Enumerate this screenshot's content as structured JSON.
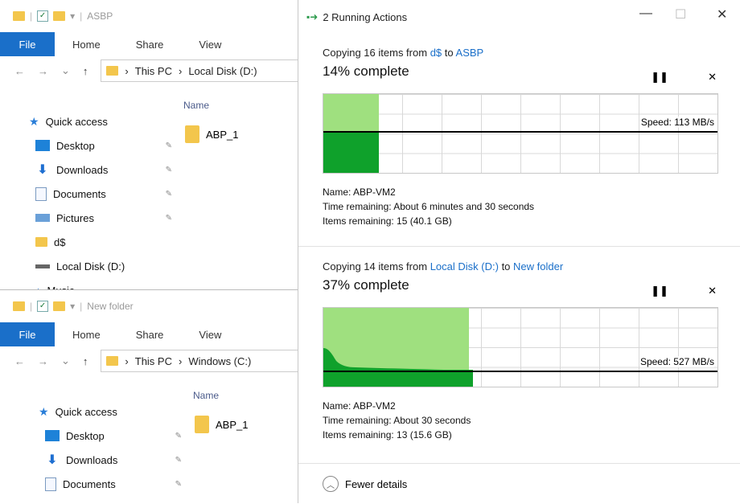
{
  "explorer_top": {
    "title": "ASBP",
    "ribbon": {
      "file": "File",
      "home": "Home",
      "share": "Share",
      "view": "View"
    },
    "address": {
      "this_pc": "This PC",
      "location": "Local Disk (D:)"
    },
    "column_header": "Name",
    "files": [
      "ABP_1"
    ],
    "nav": {
      "quick_access": "Quick access",
      "items": [
        "Desktop",
        "Downloads",
        "Documents",
        "Pictures",
        "d$",
        "Local Disk (D:)",
        "Music"
      ]
    }
  },
  "explorer_bottom": {
    "title": "New folder",
    "ribbon": {
      "file": "File",
      "home": "Home",
      "share": "Share",
      "view": "View"
    },
    "address": {
      "this_pc": "This PC",
      "location": "Windows (C:)"
    },
    "column_header": "Name",
    "files": [
      "ABP_1"
    ],
    "nav": {
      "quick_access": "Quick access",
      "items": [
        "Desktop",
        "Downloads",
        "Documents"
      ]
    }
  },
  "operations": {
    "title": "2 Running Actions",
    "copies": [
      {
        "prefix": "Copying 16 items from",
        "from": "d$",
        "to_word": "to",
        "to": "ASBP",
        "percent_text": "14% complete",
        "percent": 14,
        "speed": "Speed: 113 MB/s",
        "name": "Name:  ABP-VM2",
        "time_remaining": "Time remaining:  About 6 minutes and 30 seconds",
        "items_remaining": "Items remaining:  15 (40.1 GB)"
      },
      {
        "prefix": "Copying 14 items from",
        "from": "Local Disk (D:)",
        "to_word": "to",
        "to": "New folder",
        "percent_text": "37% complete",
        "percent": 37,
        "speed": "Speed: 527 MB/s",
        "name": "Name:  ABP-VM2",
        "time_remaining": "Time remaining:  About 30 seconds",
        "items_remaining": "Items remaining:  13 (15.6 GB)"
      }
    ],
    "fewer_details": "Fewer details"
  },
  "colors": {
    "accent": "#1a6fc9",
    "progress_light": "#9fe07f",
    "progress_dark": "#0fa12b"
  }
}
